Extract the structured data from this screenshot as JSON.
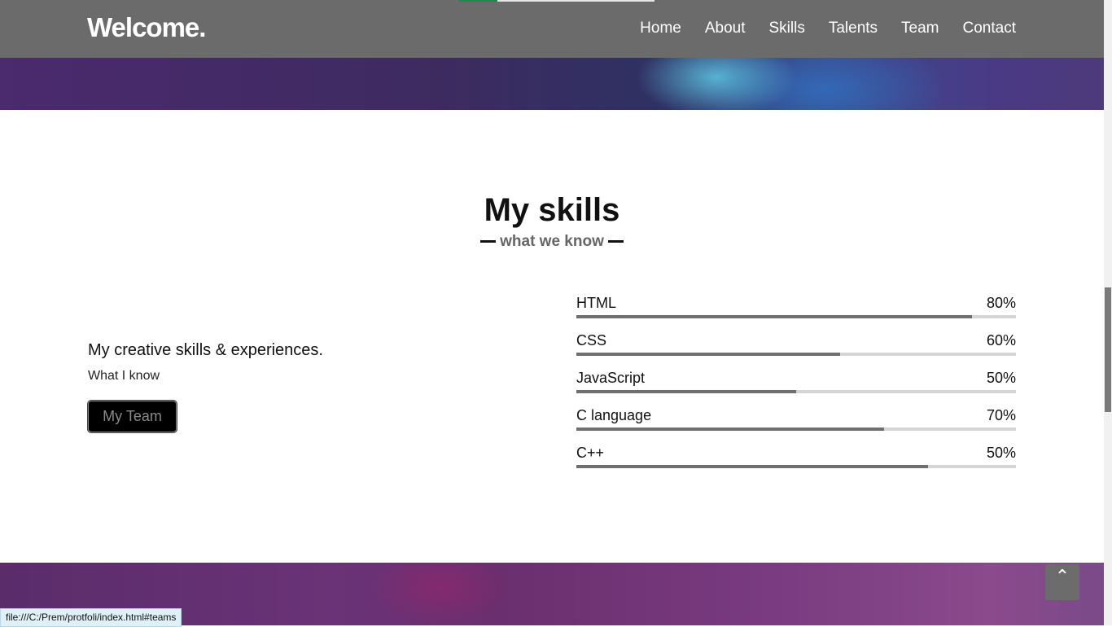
{
  "nav": {
    "brand": "Welcome.",
    "links": [
      "Home",
      "About",
      "Skills",
      "Talents",
      "Team",
      "Contact"
    ]
  },
  "skills_section": {
    "title": "My skills",
    "subtitle": "what we know"
  },
  "intro": {
    "heading": "My creative skills & experiences.",
    "text": "What I know",
    "button": "My Team"
  },
  "skills": [
    {
      "name": "HTML",
      "percent_label": "80%",
      "fill": 0.9
    },
    {
      "name": "CSS",
      "percent_label": "60%",
      "fill": 0.6
    },
    {
      "name": "JavaScript",
      "percent_label": "50%",
      "fill": 0.5
    },
    {
      "name": "C language",
      "percent_label": "70%",
      "fill": 0.7
    },
    {
      "name": "C++",
      "percent_label": "50%",
      "fill": 0.8
    }
  ],
  "back_to_top_icon": "chevron-up-icon",
  "status_bar": {
    "url": "file:///C:/Prem/protfoli/index.html#teams"
  }
}
